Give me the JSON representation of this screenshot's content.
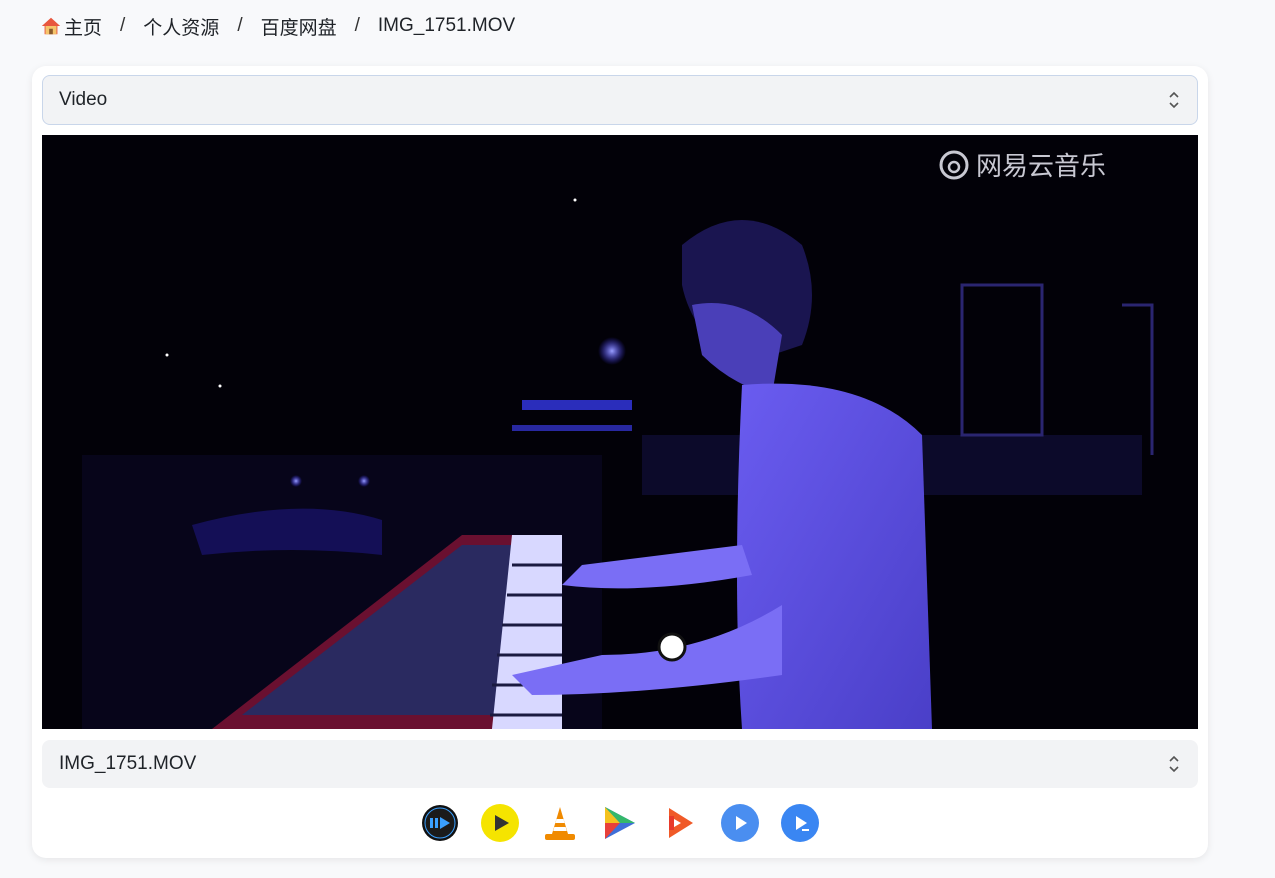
{
  "breadcrumb": {
    "home": "主页",
    "items": [
      "个人资源",
      "百度网盘",
      "IMG_1751.MOV"
    ],
    "separator": "/"
  },
  "media_type_select": {
    "value": "Video"
  },
  "video": {
    "watermark": "网易云音乐"
  },
  "file_select": {
    "value": "IMG_1751.MOV"
  },
  "players": [
    {
      "name": "iina-player-icon"
    },
    {
      "name": "potplayer-icon"
    },
    {
      "name": "vlc-icon"
    },
    {
      "name": "infuse-icon"
    },
    {
      "name": "nplayer-icon"
    },
    {
      "name": "mx-player-icon"
    },
    {
      "name": "mx-player-pro-icon"
    }
  ],
  "colors": {
    "background": "#f8f9fb",
    "card": "#ffffff",
    "select_bg": "#f2f3f5",
    "select_border": "#c9d6ea"
  }
}
